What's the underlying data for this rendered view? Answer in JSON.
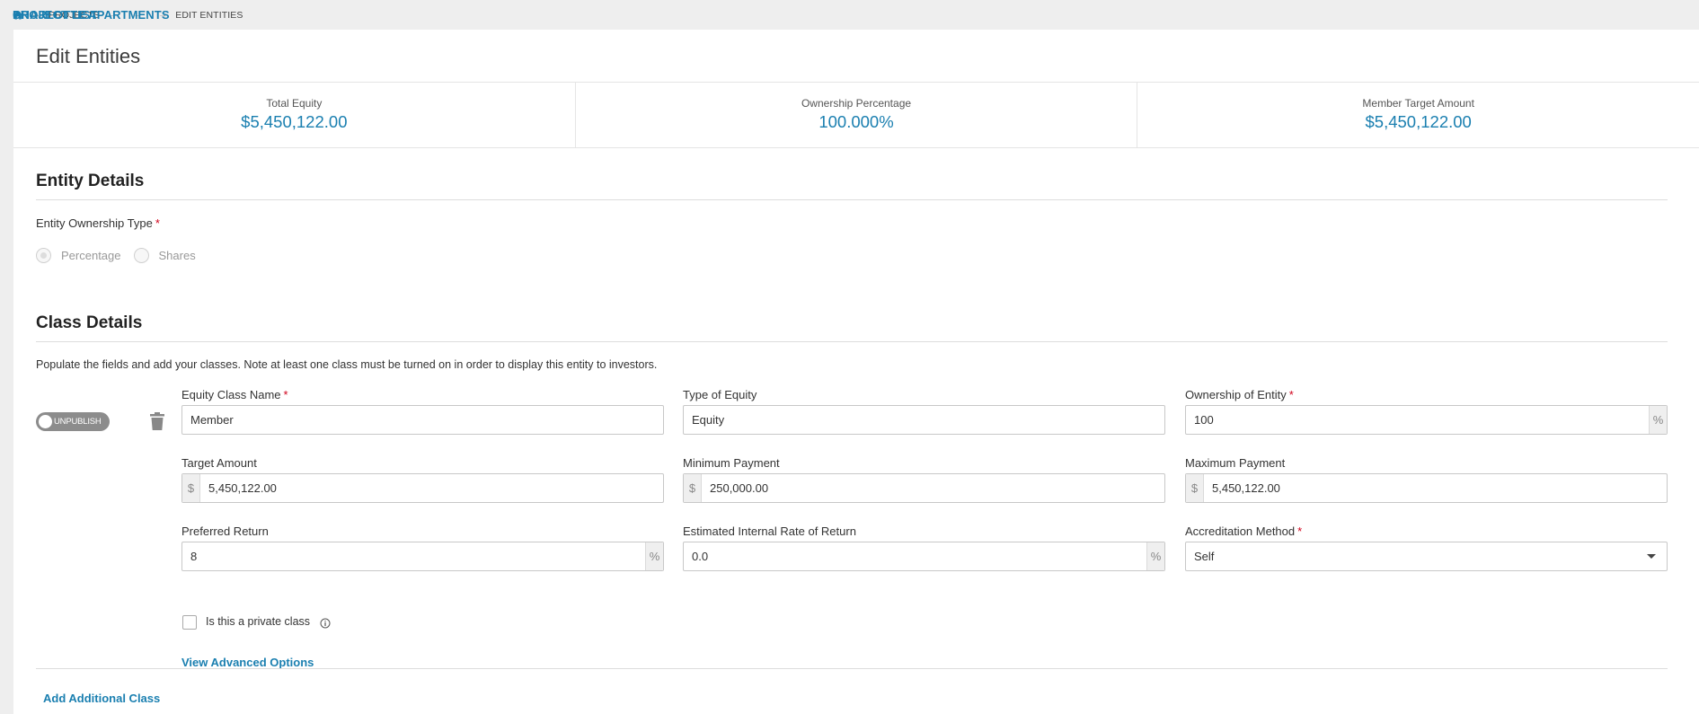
{
  "breadcrumb": {
    "items": [
      {
        "label": "PROJECTS"
      },
      {
        "label": "PROJECT LIST"
      },
      {
        "label": "CHARLOTTE APARTMENTS"
      },
      {
        "label": "EDIT ENTITIES"
      }
    ]
  },
  "page": {
    "title": "Edit Entities"
  },
  "stats": [
    {
      "label": "Total Equity",
      "value": "$5,450,122.00"
    },
    {
      "label": "Ownership Percentage",
      "value": "100.000%"
    },
    {
      "label": "Member Target Amount",
      "value": "$5,450,122.00"
    }
  ],
  "entity_details": {
    "title": "Entity Details",
    "ownership_type_label": "Entity Ownership Type",
    "required_mark": "*",
    "options": [
      "Percentage",
      "Shares"
    ],
    "selected": "Percentage"
  },
  "class_details": {
    "title": "Class Details",
    "help": "Populate the fields and add your classes. Note at least one class must be turned on in order to display this entity to investors.",
    "toggle_label": "UNPUBLISH",
    "fields": {
      "equity_class_name": {
        "label": "Equity Class Name",
        "value": "Member"
      },
      "type_of_equity": {
        "label": "Type of Equity",
        "value": "Equity"
      },
      "ownership_of_entity": {
        "label": "Ownership of Entity",
        "value": "100",
        "suffix": "%"
      },
      "target_amount": {
        "label": "Target Amount",
        "value": "5,450,122.00",
        "prefix": "$"
      },
      "minimum_payment": {
        "label": "Minimum Payment",
        "value": "250,000.00",
        "prefix": "$"
      },
      "maximum_payment": {
        "label": "Maximum Payment",
        "value": "5,450,122.00",
        "prefix": "$"
      },
      "preferred_return": {
        "label": "Preferred Return",
        "value": "8",
        "suffix": "%"
      },
      "irr": {
        "label": "Estimated Internal Rate of Return",
        "value": "0.0",
        "suffix": "%"
      },
      "accreditation_method": {
        "label": "Accreditation Method",
        "value": "Self"
      }
    },
    "private_class_label": "Is this a private class",
    "private_class_checked": false,
    "advanced_link": "View Advanced Options",
    "add_class_link": "Add Additional Class"
  },
  "colors": {
    "accent": "#1a7fb0",
    "required": "#d0021b",
    "toggle_off": "#8c8c8c"
  },
  "icons": [
    "home-icon",
    "arrow-right-icon",
    "trash-icon",
    "info-icon",
    "chevron-down-icon"
  ]
}
